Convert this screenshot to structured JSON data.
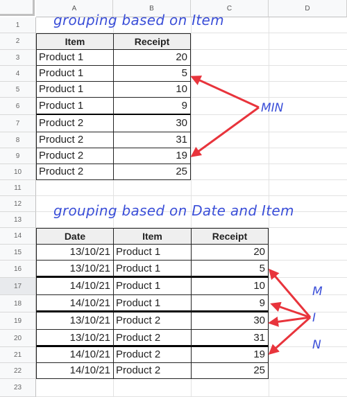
{
  "columns": [
    "A",
    "B",
    "C",
    "D"
  ],
  "rows": [
    "1",
    "2",
    "3",
    "4",
    "5",
    "6",
    "7",
    "8",
    "9",
    "10",
    "11",
    "12",
    "13",
    "14",
    "15",
    "16",
    "17",
    "18",
    "19",
    "20",
    "21",
    "22",
    "23"
  ],
  "table1": {
    "title": "grouping based on Item",
    "headers": [
      "Item",
      "Receipt"
    ],
    "rows": [
      {
        "item": "Product 1",
        "receipt": "20"
      },
      {
        "item": "Product 1",
        "receipt": "5"
      },
      {
        "item": "Product 1",
        "receipt": "10"
      },
      {
        "item": "Product 1",
        "receipt": "9"
      },
      {
        "item": "Product 2",
        "receipt": "30"
      },
      {
        "item": "Product 2",
        "receipt": "31"
      },
      {
        "item": "Product 2",
        "receipt": "19"
      },
      {
        "item": "Product 2",
        "receipt": "25"
      }
    ],
    "annotation": "MIN"
  },
  "table2": {
    "title": "grouping based on Date and Item",
    "headers": [
      "Date",
      "Item",
      "Receipt"
    ],
    "rows": [
      {
        "date": "13/10/21",
        "item": "Product 1",
        "receipt": "20"
      },
      {
        "date": "13/10/21",
        "item": "Product 1",
        "receipt": "5"
      },
      {
        "date": "14/10/21",
        "item": "Product 1",
        "receipt": "10"
      },
      {
        "date": "14/10/21",
        "item": "Product 1",
        "receipt": "9"
      },
      {
        "date": "13/10/21",
        "item": "Product 2",
        "receipt": "30"
      },
      {
        "date": "13/10/21",
        "item": "Product 2",
        "receipt": "31"
      },
      {
        "date": "14/10/21",
        "item": "Product 2",
        "receipt": "19"
      },
      {
        "date": "14/10/21",
        "item": "Product 2",
        "receipt": "25"
      }
    ],
    "annotation": [
      "M",
      "I",
      "N"
    ]
  },
  "colors": {
    "annotation_text": "#3b4fd8",
    "arrow": "#e8343c",
    "header_fill": "#efefef"
  }
}
